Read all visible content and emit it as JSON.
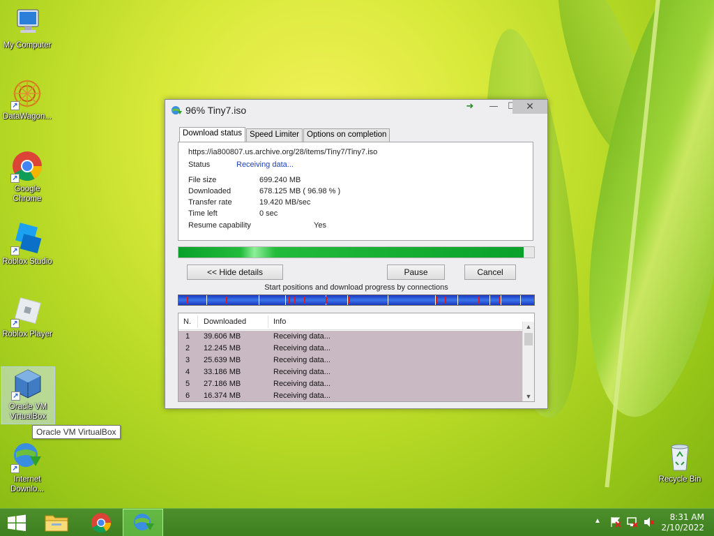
{
  "desktop": {
    "icons": [
      {
        "label_line1": "My Computer",
        "label_line2": ""
      },
      {
        "label_line1": "DataWagon...",
        "label_line2": ""
      },
      {
        "label_line1": "Google",
        "label_line2": "Chrome"
      },
      {
        "label_line1": "Roblox Studio",
        "label_line2": ""
      },
      {
        "label_line1": "Roblox Player",
        "label_line2": ""
      },
      {
        "label_line1": "Oracle VM",
        "label_line2": "VirtualBox"
      },
      {
        "label_line1": "Internet",
        "label_line2": "Downlo..."
      },
      {
        "label_line1": "Recycle Bin",
        "label_line2": ""
      }
    ],
    "tooltip": "Oracle VM VirtualBox"
  },
  "window": {
    "title": "96% Tiny7.iso",
    "tabs": [
      "Download status",
      "Speed Limiter",
      "Options on completion"
    ],
    "url": "https://ia800807.us.archive.org/28/items/Tiny7/Tiny7.iso",
    "status_label": "Status",
    "status_value": "Receiving data...",
    "file_size_label": "File size",
    "file_size_value": "699.240  MB",
    "downloaded_label": "Downloaded",
    "downloaded_value": "678.125  MB  ( 96.98 % )",
    "transfer_rate_label": "Transfer rate",
    "transfer_rate_value": "19.420  MB/sec",
    "time_left_label": "Time left",
    "time_left_value": "0 sec",
    "resume_label": "Resume capability",
    "resume_value": "Yes",
    "progress_percent": 96.98,
    "hide_details_label": "<< Hide details",
    "pause_label": "Pause",
    "cancel_label": "Cancel",
    "connections_caption": "Start positions and download progress by connections",
    "table": {
      "headers": [
        "N.",
        "Downloaded",
        "Info"
      ],
      "rows": [
        {
          "n": "1",
          "downloaded": "39.606  MB",
          "info": "Receiving data..."
        },
        {
          "n": "2",
          "downloaded": "12.245  MB",
          "info": "Receiving data..."
        },
        {
          "n": "3",
          "downloaded": "25.639  MB",
          "info": "Receiving data..."
        },
        {
          "n": "4",
          "downloaded": "33.186  MB",
          "info": "Receiving data..."
        },
        {
          "n": "5",
          "downloaded": "27.186  MB",
          "info": "Receiving data..."
        },
        {
          "n": "6",
          "downloaded": "16.374  MB",
          "info": "Receiving data..."
        }
      ]
    },
    "colors": {
      "progress": "#0aa12b",
      "connections": "#1b39c4",
      "status_value": "#1a3fb8"
    }
  },
  "taskbar": {
    "clock_time": "8:31 AM",
    "clock_date": "2/10/2022",
    "tray_icons": [
      "show-hidden-icon",
      "action-center-flag-icon",
      "network-icon",
      "volume-muted-icon"
    ]
  }
}
